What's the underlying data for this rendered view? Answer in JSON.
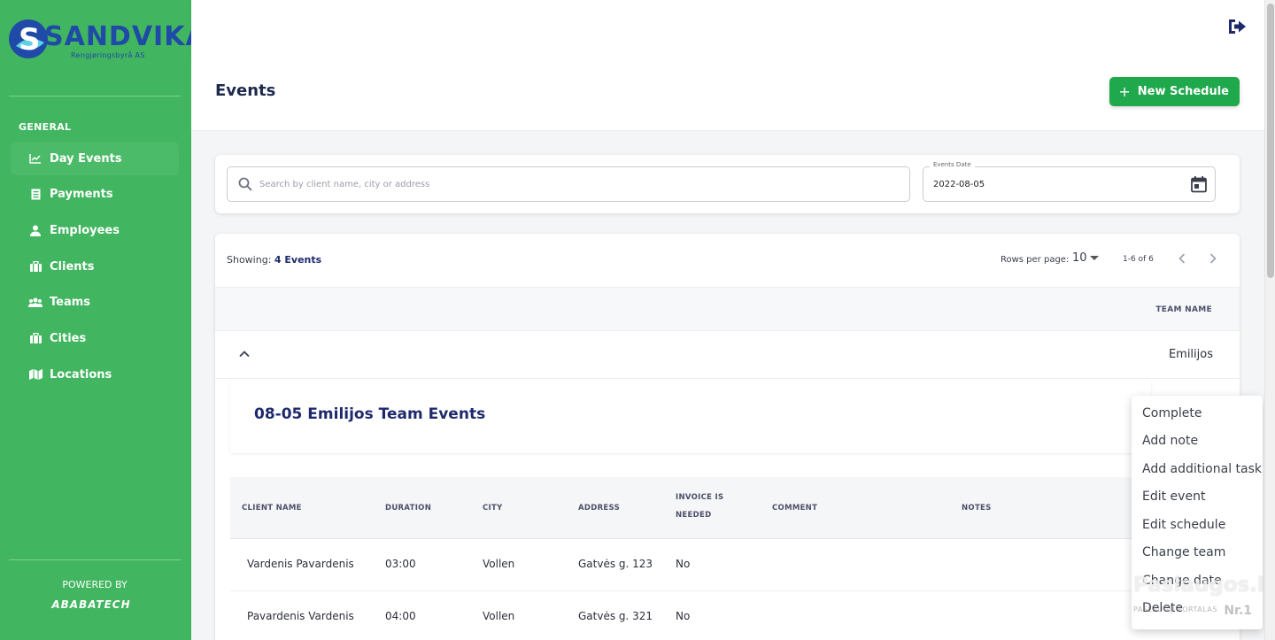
{
  "brand": {
    "name": "SANDVIKA",
    "subtitle": "Rengjøringsbyrå AS",
    "logo_letter": "S",
    "colors": {
      "sidebar": "#41b55f",
      "primary_button": "#20a84c",
      "heading": "#1e2a6d"
    }
  },
  "sidebar": {
    "section_label": "GENERAL",
    "items": [
      {
        "label": "Day Events",
        "icon": "chart-line-icon",
        "active": true
      },
      {
        "label": "Payments",
        "icon": "receipt-icon",
        "active": false
      },
      {
        "label": "Employees",
        "icon": "person-icon",
        "active": false
      },
      {
        "label": "Clients",
        "icon": "briefcase-icon",
        "active": false
      },
      {
        "label": "Teams",
        "icon": "group-icon",
        "active": false
      },
      {
        "label": "Cities",
        "icon": "city-icon",
        "active": false
      },
      {
        "label": "Locations",
        "icon": "map-icon",
        "active": false
      }
    ],
    "powered_by": "POWERED BY",
    "powered_brand": "ABABATECH"
  },
  "header": {
    "logout_icon": "logout-icon"
  },
  "page": {
    "title": "Events",
    "new_schedule_label": "New Schedule"
  },
  "filters": {
    "search_placeholder": "Search by client name, city or address",
    "date_label": "Events Date",
    "date_value": "2022-08-05"
  },
  "table": {
    "showing_prefix": "Showing:",
    "showing_count": "4 Events",
    "rows_per_page_label": "Rows per page:",
    "rows_per_page_value": "10",
    "range": "1-6 of 6",
    "team_header": "TEAM NAME",
    "group": {
      "team": "Emilijos",
      "title": "08-05 Emilijos Team Events",
      "columns": [
        "CLIENT NAME",
        "DURATION",
        "CITY",
        "ADDRESS",
        "INVOICE IS NEEDED",
        "COMMENT",
        "NOTES"
      ],
      "rows": [
        {
          "client": "Vardenis Pavardenis",
          "duration": "03:00",
          "city": "Vollen",
          "address": "Gatvės g. 123",
          "invoice": "No"
        },
        {
          "client": "Pavardenis Vardenis",
          "duration": "04:00",
          "city": "Vollen",
          "address": "Gatvės g. 321",
          "invoice": "No"
        }
      ]
    }
  },
  "context_menu": {
    "items": [
      "Complete",
      "Add note",
      "Add additional task",
      "Edit event",
      "Edit schedule",
      "Change team",
      "Change date",
      "Delete"
    ]
  },
  "watermark": {
    "main": "Paslaugos.lt",
    "sub": "PASLAUGŲ PORTALAS",
    "nr": "Nr.1"
  }
}
